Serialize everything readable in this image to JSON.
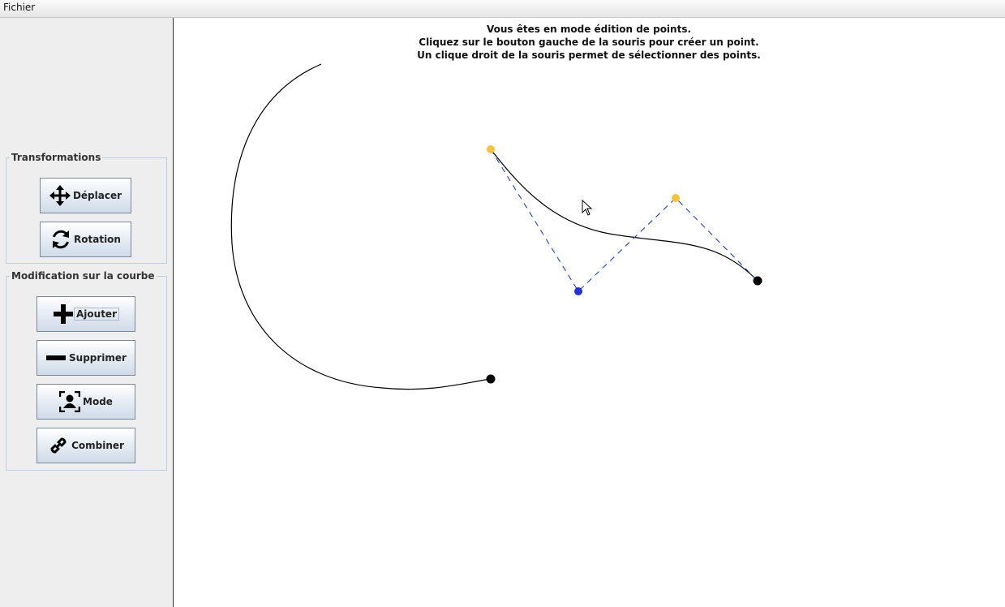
{
  "menubar": {
    "items": [
      "Fichier"
    ]
  },
  "sidebar": {
    "transformations": {
      "title": "Transformations",
      "buttons": [
        {
          "label": "Déplacer",
          "icon": "move-arrows-icon"
        },
        {
          "label": "Rotation",
          "icon": "rotate-icon"
        }
      ]
    },
    "modification": {
      "title": "Modification sur la courbe",
      "buttons": [
        {
          "label": "Ajouter",
          "icon": "plus-icon"
        },
        {
          "label": "Supprimer",
          "icon": "minus-icon"
        },
        {
          "label": "Mode",
          "icon": "user-frame-icon"
        },
        {
          "label": "Combiner",
          "icon": "link-icon"
        }
      ]
    }
  },
  "canvas": {
    "info_lines": [
      "Vous êtes en mode édition de points.",
      "Cliquez sur le bouton gauche de la souris pour créer un point.",
      "Un clique droit de la souris permet de sélectionner des points."
    ],
    "colors": {
      "curve": "#000000",
      "selected_point": "#f5c242",
      "control_point": "#2233cc",
      "anchor_point": "#000000",
      "control_line": "#2244aa"
    }
  }
}
